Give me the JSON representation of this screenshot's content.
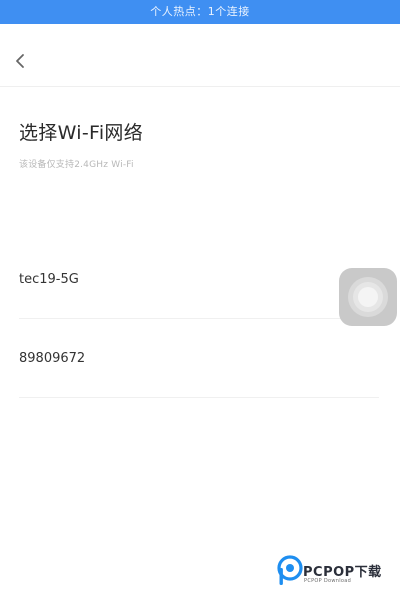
{
  "status_bar": {
    "text": "个人热点：1个连接",
    "color": "#3f8ff2"
  },
  "nav": {
    "back_icon": "chevron-left-icon"
  },
  "header": {
    "title": "选择Wi-Fi网络",
    "subtitle": "该设备仅支持2.4GHz Wi-Fi"
  },
  "wifi_list": {
    "items": [
      {
        "ssid": "tec19-5G"
      },
      {
        "ssid": "89809672"
      }
    ]
  },
  "assistive_touch": {
    "icon": "assistive-touch-icon"
  },
  "watermark": {
    "brand": "PCPOP下载",
    "tagline": "PCPOP Download"
  }
}
